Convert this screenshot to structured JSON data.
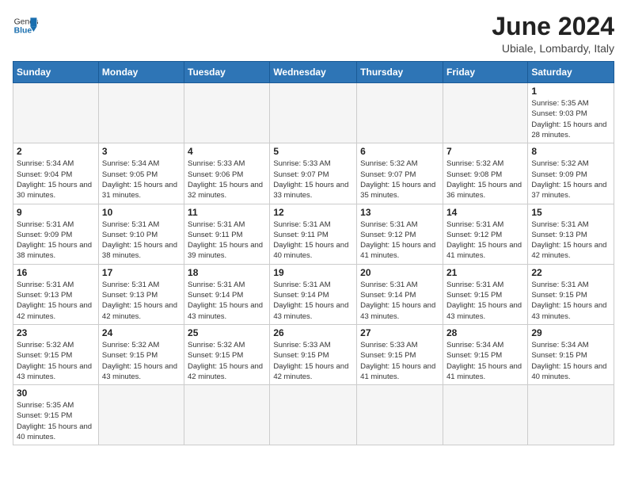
{
  "header": {
    "logo_general": "General",
    "logo_blue": "Blue",
    "month_year": "June 2024",
    "location": "Ubiale, Lombardy, Italy"
  },
  "weekdays": [
    "Sunday",
    "Monday",
    "Tuesday",
    "Wednesday",
    "Thursday",
    "Friday",
    "Saturday"
  ],
  "weeks": [
    [
      {
        "day": "",
        "empty": true
      },
      {
        "day": "",
        "empty": true
      },
      {
        "day": "",
        "empty": true
      },
      {
        "day": "",
        "empty": true
      },
      {
        "day": "",
        "empty": true
      },
      {
        "day": "",
        "empty": true
      },
      {
        "day": "1",
        "sunrise": "5:35 AM",
        "sunset": "9:03 PM",
        "daylight": "15 hours and 28 minutes."
      }
    ],
    [
      {
        "day": "2",
        "sunrise": "5:34 AM",
        "sunset": "9:04 PM",
        "daylight": "15 hours and 30 minutes."
      },
      {
        "day": "3",
        "sunrise": "5:34 AM",
        "sunset": "9:05 PM",
        "daylight": "15 hours and 31 minutes."
      },
      {
        "day": "4",
        "sunrise": "5:33 AM",
        "sunset": "9:06 PM",
        "daylight": "15 hours and 32 minutes."
      },
      {
        "day": "5",
        "sunrise": "5:33 AM",
        "sunset": "9:07 PM",
        "daylight": "15 hours and 33 minutes."
      },
      {
        "day": "6",
        "sunrise": "5:32 AM",
        "sunset": "9:07 PM",
        "daylight": "15 hours and 35 minutes."
      },
      {
        "day": "7",
        "sunrise": "5:32 AM",
        "sunset": "9:08 PM",
        "daylight": "15 hours and 36 minutes."
      },
      {
        "day": "8",
        "sunrise": "5:32 AM",
        "sunset": "9:09 PM",
        "daylight": "15 hours and 37 minutes."
      }
    ],
    [
      {
        "day": "9",
        "sunrise": "5:31 AM",
        "sunset": "9:09 PM",
        "daylight": "15 hours and 38 minutes."
      },
      {
        "day": "10",
        "sunrise": "5:31 AM",
        "sunset": "9:10 PM",
        "daylight": "15 hours and 38 minutes."
      },
      {
        "day": "11",
        "sunrise": "5:31 AM",
        "sunset": "9:11 PM",
        "daylight": "15 hours and 39 minutes."
      },
      {
        "day": "12",
        "sunrise": "5:31 AM",
        "sunset": "9:11 PM",
        "daylight": "15 hours and 40 minutes."
      },
      {
        "day": "13",
        "sunrise": "5:31 AM",
        "sunset": "9:12 PM",
        "daylight": "15 hours and 41 minutes."
      },
      {
        "day": "14",
        "sunrise": "5:31 AM",
        "sunset": "9:12 PM",
        "daylight": "15 hours and 41 minutes."
      },
      {
        "day": "15",
        "sunrise": "5:31 AM",
        "sunset": "9:13 PM",
        "daylight": "15 hours and 42 minutes."
      }
    ],
    [
      {
        "day": "16",
        "sunrise": "5:31 AM",
        "sunset": "9:13 PM",
        "daylight": "15 hours and 42 minutes."
      },
      {
        "day": "17",
        "sunrise": "5:31 AM",
        "sunset": "9:13 PM",
        "daylight": "15 hours and 42 minutes."
      },
      {
        "day": "18",
        "sunrise": "5:31 AM",
        "sunset": "9:14 PM",
        "daylight": "15 hours and 43 minutes."
      },
      {
        "day": "19",
        "sunrise": "5:31 AM",
        "sunset": "9:14 PM",
        "daylight": "15 hours and 43 minutes."
      },
      {
        "day": "20",
        "sunrise": "5:31 AM",
        "sunset": "9:14 PM",
        "daylight": "15 hours and 43 minutes."
      },
      {
        "day": "21",
        "sunrise": "5:31 AM",
        "sunset": "9:15 PM",
        "daylight": "15 hours and 43 minutes."
      },
      {
        "day": "22",
        "sunrise": "5:31 AM",
        "sunset": "9:15 PM",
        "daylight": "15 hours and 43 minutes."
      }
    ],
    [
      {
        "day": "23",
        "sunrise": "5:32 AM",
        "sunset": "9:15 PM",
        "daylight": "15 hours and 43 minutes."
      },
      {
        "day": "24",
        "sunrise": "5:32 AM",
        "sunset": "9:15 PM",
        "daylight": "15 hours and 43 minutes."
      },
      {
        "day": "25",
        "sunrise": "5:32 AM",
        "sunset": "9:15 PM",
        "daylight": "15 hours and 42 minutes."
      },
      {
        "day": "26",
        "sunrise": "5:33 AM",
        "sunset": "9:15 PM",
        "daylight": "15 hours and 42 minutes."
      },
      {
        "day": "27",
        "sunrise": "5:33 AM",
        "sunset": "9:15 PM",
        "daylight": "15 hours and 41 minutes."
      },
      {
        "day": "28",
        "sunrise": "5:34 AM",
        "sunset": "9:15 PM",
        "daylight": "15 hours and 41 minutes."
      },
      {
        "day": "29",
        "sunrise": "5:34 AM",
        "sunset": "9:15 PM",
        "daylight": "15 hours and 40 minutes."
      }
    ],
    [
      {
        "day": "30",
        "sunrise": "5:35 AM",
        "sunset": "9:15 PM",
        "daylight": "15 hours and 40 minutes."
      },
      {
        "day": "",
        "empty": true
      },
      {
        "day": "",
        "empty": true
      },
      {
        "day": "",
        "empty": true
      },
      {
        "day": "",
        "empty": true
      },
      {
        "day": "",
        "empty": true
      },
      {
        "day": "",
        "empty": true
      }
    ]
  ]
}
